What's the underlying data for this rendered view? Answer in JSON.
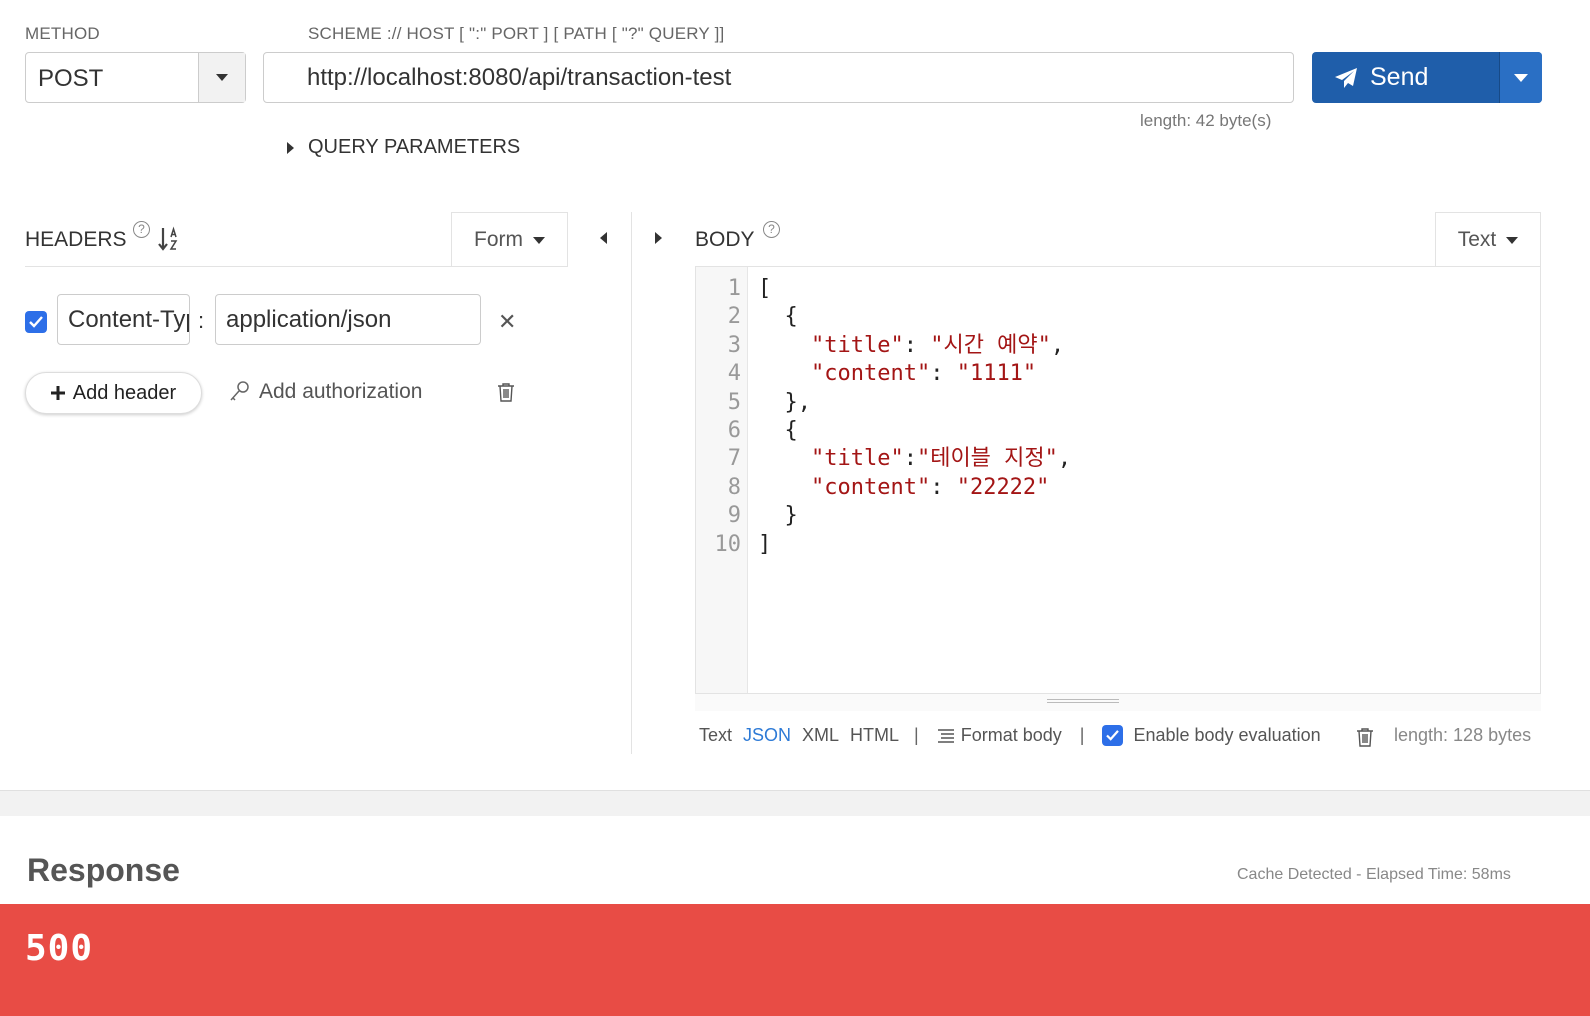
{
  "request": {
    "method_label": "METHOD",
    "url_label": "SCHEME :// HOST [ \":\" PORT ] [ PATH [ \"?\" QUERY ]]",
    "method": "POST",
    "url": "http://localhost:8080/api/transaction-test",
    "url_length": "length: 42 byte(s)",
    "send_label": "Send",
    "query_parameters_label": "QUERY PARAMETERS"
  },
  "headers": {
    "title": "HEADERS",
    "help": "?",
    "mode": "Form",
    "items": [
      {
        "checked": true,
        "name": "Content-Type",
        "value": "application/json"
      }
    ],
    "add_header_label": "Add header",
    "add_authorization_label": "Add authorization"
  },
  "body": {
    "title": "BODY",
    "help": "?",
    "mode": "Text",
    "line_numbers": [
      "1",
      "2",
      "3",
      "4",
      "5",
      "6",
      "7",
      "8",
      "9",
      "10"
    ],
    "formats": [
      "Text",
      "JSON",
      "XML",
      "HTML"
    ],
    "active_format": "JSON",
    "format_body_label": "Format body",
    "enable_eval_label": "Enable body evaluation",
    "enable_eval_checked": true,
    "length": "length: 128 bytes",
    "code_lines": [
      "[",
      "  {",
      "    \"title\": \"시간 예약\",",
      "    \"content\": \"1111\"",
      "  },",
      "  {",
      "    \"title\":\"테이블 지정\",",
      "    \"content\": \"22222\"",
      "  }",
      "]"
    ]
  },
  "response": {
    "title": "Response",
    "meta": "Cache Detected -  Elapsed Time: 58ms",
    "status_code": "500",
    "status_color": "#e84c45"
  },
  "colors": {
    "send_button": "#1f5eaa",
    "checkbox": "#2d6fe8",
    "string": "#a31515"
  }
}
